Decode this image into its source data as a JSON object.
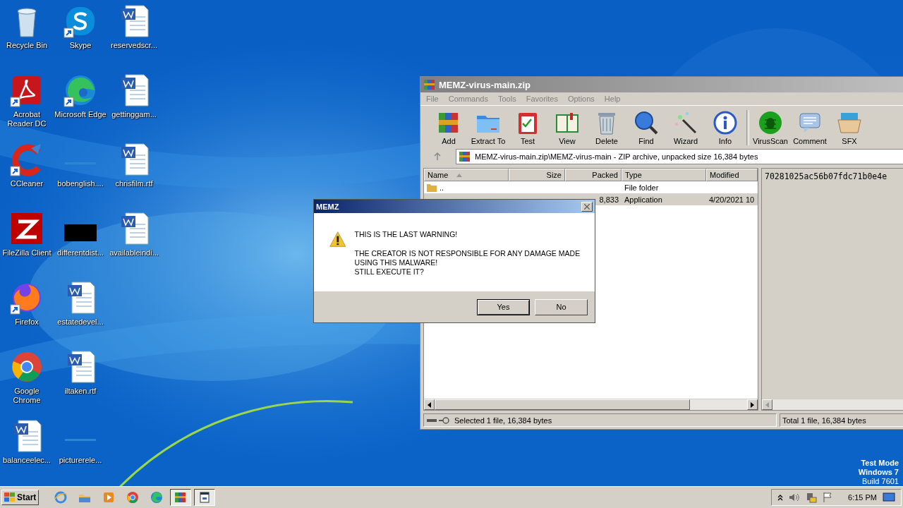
{
  "desktop": {
    "icons": [
      {
        "label": "Recycle Bin",
        "kind": "recycle",
        "shortcut": false
      },
      {
        "label": "Acrobat Reader DC",
        "kind": "acrobat",
        "shortcut": true
      },
      {
        "label": "CCleaner",
        "kind": "ccleaner",
        "shortcut": true
      },
      {
        "label": "FileZilla Client",
        "kind": "filezilla",
        "shortcut": false
      },
      {
        "label": "Firefox",
        "kind": "firefox",
        "shortcut": true
      },
      {
        "label": "Google Chrome",
        "kind": "chrome",
        "shortcut": false
      },
      {
        "label": "balanceelec...",
        "kind": "word",
        "shortcut": false
      },
      {
        "label": "Skype",
        "kind": "skype",
        "shortcut": true
      },
      {
        "label": "Microsoft Edge",
        "kind": "edge",
        "shortcut": true
      },
      {
        "label": "bobenglish....",
        "kind": "blank",
        "shortcut": false
      },
      {
        "label": "differentdist...",
        "kind": "black",
        "shortcut": false
      },
      {
        "label": "estatedevel...",
        "kind": "word",
        "shortcut": false
      },
      {
        "label": "iltaken.rtf",
        "kind": "word",
        "shortcut": false
      },
      {
        "label": "picturerele...",
        "kind": "blank",
        "shortcut": false
      },
      {
        "label": "reservedscr...",
        "kind": "word",
        "shortcut": false
      },
      {
        "label": "gettinggam...",
        "kind": "word",
        "shortcut": false
      },
      {
        "label": "chrisfilm.rtf",
        "kind": "word",
        "shortcut": false
      },
      {
        "label": "availableindi...",
        "kind": "word",
        "shortcut": false
      }
    ]
  },
  "winrar": {
    "title": "MEMZ-virus-main.zip",
    "menu": [
      "File",
      "Commands",
      "Tools",
      "Favorites",
      "Options",
      "Help"
    ],
    "toolbar": [
      {
        "label": "Add",
        "kind": "books"
      },
      {
        "label": "Extract To",
        "kind": "folder"
      },
      {
        "label": "Test",
        "kind": "clipboard"
      },
      {
        "label": "View",
        "kind": "book"
      },
      {
        "label": "Delete",
        "kind": "trash"
      },
      {
        "label": "Find",
        "kind": "search"
      },
      {
        "label": "Wizard",
        "kind": "wand"
      },
      {
        "label": "Info",
        "kind": "info"
      },
      {
        "label": "VirusScan",
        "kind": "bug"
      },
      {
        "label": "Comment",
        "kind": "comment"
      },
      {
        "label": "SFX",
        "kind": "box"
      }
    ],
    "path": "MEMZ-virus-main.zip\\MEMZ-virus-main - ZIP archive, unpacked size 16,384 bytes",
    "columns": [
      "Name",
      "Size",
      "Packed",
      "Type",
      "Modified"
    ],
    "rows": [
      {
        "name": "..",
        "type": "File folder",
        "selected": false
      },
      {
        "packed": "8,833",
        "type": "Application",
        "modified": "4/20/2021 10",
        "selected": true
      }
    ],
    "comment": "70281025ac56b07fdc71b0e4e",
    "status_left": "Selected 1 file, 16,384 bytes",
    "status_right": "Total 1 file, 16,384 bytes"
  },
  "dialog": {
    "title": "MEMZ",
    "lines": [
      "THIS IS THE LAST WARNING!",
      "THE CREATOR IS NOT RESPONSIBLE FOR ANY DAMAGE MADE USING THIS MALWARE!\nSTILL EXECUTE IT?"
    ],
    "buttons": [
      {
        "label": "Yes",
        "default": true
      },
      {
        "label": "No",
        "default": false
      }
    ]
  },
  "os_notice": [
    "Test Mode",
    "Windows 7",
    "Build 7601"
  ],
  "taskbar": {
    "start": "Start",
    "apps": [
      {
        "kind": "ie",
        "active": false
      },
      {
        "kind": "explorer",
        "active": false
      },
      {
        "kind": "media",
        "active": false
      },
      {
        "kind": "chrome",
        "active": false
      },
      {
        "kind": "edge",
        "active": false
      },
      {
        "kind": "winrar",
        "active": true
      },
      {
        "kind": "window",
        "active": true
      }
    ],
    "clock": "6:15 PM"
  }
}
